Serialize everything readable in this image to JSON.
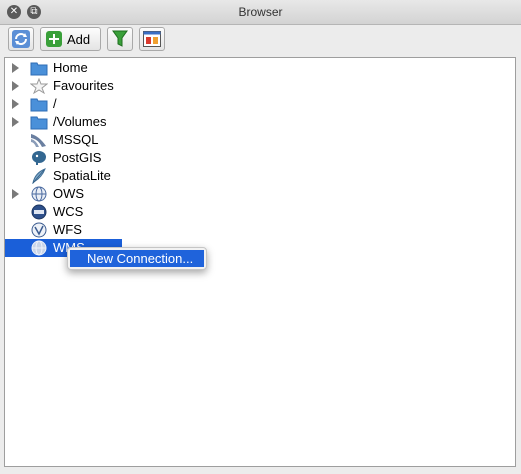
{
  "window": {
    "title": "Browser"
  },
  "toolbar": {
    "add_label": "Add"
  },
  "tree": {
    "items": [
      {
        "label": "Home",
        "icon": "folder-icon",
        "expandable": true
      },
      {
        "label": "Favourites",
        "icon": "star-icon",
        "expandable": true
      },
      {
        "label": "/",
        "icon": "folder-icon",
        "expandable": true
      },
      {
        "label": "/Volumes",
        "icon": "folder-icon",
        "expandable": true
      },
      {
        "label": "MSSQL",
        "icon": "mssql-icon",
        "expandable": false
      },
      {
        "label": "PostGIS",
        "icon": "postgis-elephant-icon",
        "expandable": false
      },
      {
        "label": "SpatiaLite",
        "icon": "spatialite-feather-icon",
        "expandable": false
      },
      {
        "label": "OWS",
        "icon": "globe-icon",
        "expandable": true
      },
      {
        "label": "WCS",
        "icon": "wcs-globe-icon",
        "expandable": false
      },
      {
        "label": "WFS",
        "icon": "wfs-globe-icon",
        "expandable": false
      },
      {
        "label": "WMS",
        "icon": "wms-globe-icon",
        "expandable": false,
        "selected": true
      }
    ]
  },
  "context_menu": {
    "items": [
      {
        "label": "New Connection..."
      }
    ]
  },
  "colors": {
    "selection": "#1a5fd9",
    "folder": "#4a90d9"
  }
}
